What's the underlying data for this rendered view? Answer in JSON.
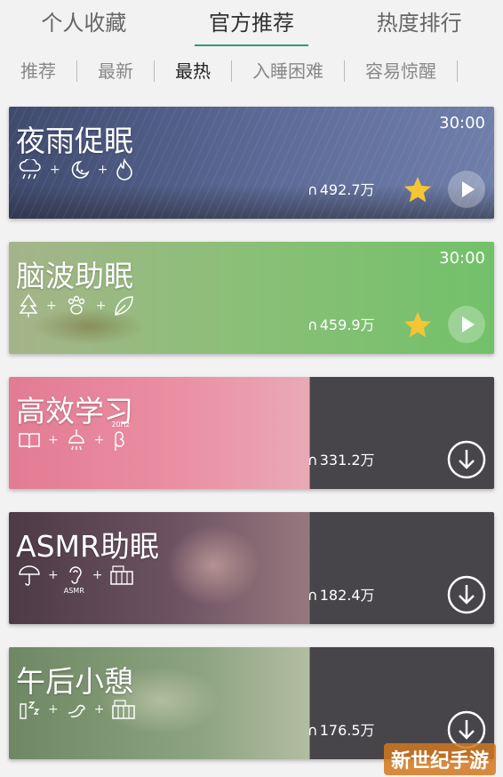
{
  "tabs": [
    {
      "label": "个人收藏",
      "active": false
    },
    {
      "label": "官方推荐",
      "active": true
    },
    {
      "label": "热度排行",
      "active": false
    }
  ],
  "filters": [
    {
      "label": "推荐",
      "active": false
    },
    {
      "label": "最新",
      "active": false
    },
    {
      "label": "最热",
      "active": true
    },
    {
      "label": "入睡困难",
      "active": false
    },
    {
      "label": "容易惊醒",
      "active": false
    }
  ],
  "cards": [
    {
      "title": "夜雨促眠",
      "duration": "30:00",
      "count": "492.7万",
      "action": "play",
      "favorite": true,
      "icons": [
        "cloud-rain-icon",
        "moon-icon",
        "fire-icon"
      ],
      "color": "#5f6e9c"
    },
    {
      "title": "脑波助眠",
      "duration": "30:00",
      "count": "459.9万",
      "action": "play",
      "favorite": true,
      "icons": [
        "tree-icon",
        "paw-icon",
        "leaf-icon"
      ],
      "color": "#7cc06c"
    },
    {
      "title": "高效学习",
      "count": "331.2万",
      "action": "download",
      "icons": [
        "book-icon",
        "hanging-lamp-icon",
        "beta-wave-icon"
      ],
      "icon_label": "20Hz",
      "color": "#e8879c"
    },
    {
      "title": "ASMR助眠",
      "count": "182.4万",
      "action": "download",
      "icons": [
        "umbrella-icon",
        "ear-icon",
        "piano-icon"
      ],
      "icon_label": "ASMR",
      "color": "#7a5a66"
    },
    {
      "title": "午后小憩",
      "count": "176.5万",
      "action": "download",
      "icons": [
        "sleep-icon",
        "bird-icon",
        "piano-icon"
      ],
      "color": "#7d9a6e"
    }
  ],
  "watermark": "新世纪手游",
  "colors": {
    "accent": "#2e9c74",
    "star": "#f4c534",
    "dark_panel": "#48454a"
  }
}
